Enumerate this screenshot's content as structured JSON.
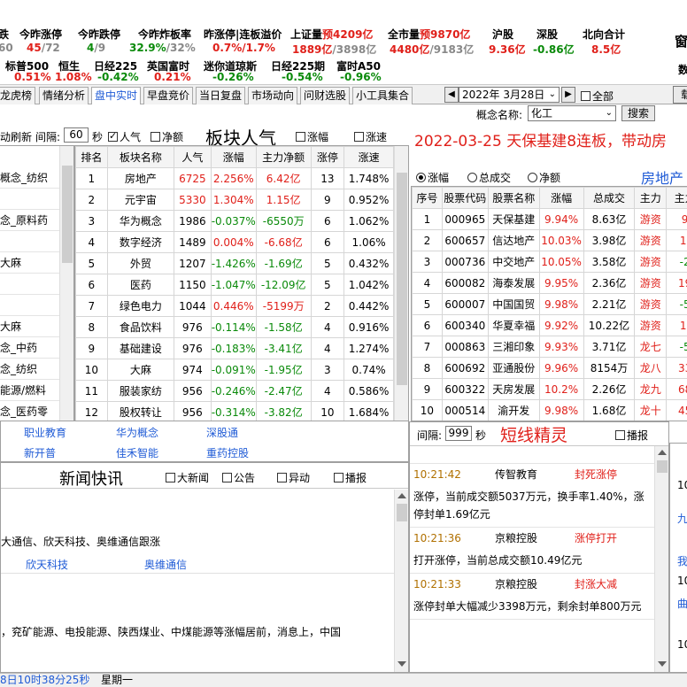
{
  "market": {
    "row1": [
      {
        "label": "涨停",
        "value": "45",
        "value2": "/72"
      },
      {
        "label": "今昨涨停",
        "value": "45",
        "value2": "/72"
      },
      {
        "label": "今昨跌停",
        "value": "4",
        "value2": "/9"
      },
      {
        "label": "今昨炸板率",
        "value": "32.9%",
        "value2": "/32%"
      },
      {
        "label": "昨涨停|连板溢价",
        "value": "0.7%",
        "value2": "/1.7%"
      },
      {
        "label": "上证量",
        "label_red": "预4209亿",
        "value": "1889亿",
        "value2": "/3898亿"
      },
      {
        "label": "全市量",
        "label_red": "预9870亿",
        "value": "4480亿",
        "value2": "/9183亿"
      },
      {
        "label": "沪股",
        "value": "9.36亿"
      },
      {
        "label": "深股",
        "value": "-0.86亿"
      },
      {
        "label": "北向合计",
        "value": "8.5亿"
      }
    ],
    "col0_label_tail": "跌",
    "col0_value_tail": "60",
    "row2": [
      {
        "label": "标普500",
        "value": "0.51%"
      },
      {
        "label": "恒生",
        "value": "1.08%"
      },
      {
        "label": "日经225",
        "value": "-0.42%"
      },
      {
        "label": "英国富时",
        "value": "0.21%"
      },
      {
        "label": "迷你道琼斯",
        "value": "-0.26%"
      },
      {
        "label": "日经225期",
        "value": "-0.54%"
      },
      {
        "label": "富时A50",
        "value": "-0.96%"
      }
    ],
    "right_edge1": "窗",
    "right_edge2": "数"
  },
  "tabs": [
    "龙虎榜",
    "情绪分析",
    "盘中实时",
    "早盘竞价",
    "当日复盘",
    "市场动向",
    "问财选股",
    "小工具集合"
  ],
  "active_tab": "盘中实时",
  "date": {
    "prev": "◀",
    "value": "2022年  3月28日",
    "next": "▶",
    "all_label": "全部",
    "concept_label": "概念名称:",
    "concept_value": "化工",
    "search": "搜索",
    "right_btn": "载"
  },
  "board": {
    "refresh_label": "动刷新",
    "interval_label": "间隔:",
    "interval_value": "60",
    "sec": "秒",
    "popularity": "人气",
    "net": "净额",
    "title": "板块人气",
    "rise": "涨幅",
    "speed": "涨速",
    "headers": [
      "排名",
      "板块名称",
      "人气",
      "涨幅",
      "主力净额",
      "涨停",
      "涨速"
    ],
    "rows": [
      [
        "1",
        "房地产",
        "6725",
        "2.256%",
        "6.42亿",
        "13",
        "1.748%"
      ],
      [
        "2",
        "元宇宙",
        "5330",
        "1.304%",
        "1.15亿",
        "9",
        "0.952%"
      ],
      [
        "3",
        "华为概念",
        "1986",
        "-0.037%",
        "-6550万",
        "6",
        "1.062%"
      ],
      [
        "4",
        "数字经济",
        "1489",
        "0.004%",
        "-6.68亿",
        "6",
        "1.06%"
      ],
      [
        "5",
        "外贸",
        "1207",
        "-1.426%",
        "-1.69亿",
        "5",
        "0.432%"
      ],
      [
        "6",
        "医药",
        "1150",
        "-1.047%",
        "-12.09亿",
        "5",
        "1.042%"
      ],
      [
        "7",
        "绿色电力",
        "1044",
        "0.446%",
        "-5199万",
        "2",
        "0.442%"
      ],
      [
        "8",
        "食品饮料",
        "976",
        "-0.114%",
        "-1.58亿",
        "4",
        "0.916%"
      ],
      [
        "9",
        "基础建设",
        "976",
        "-0.183%",
        "-3.41亿",
        "4",
        "1.274%"
      ],
      [
        "10",
        "大麻",
        "974",
        "-0.091%",
        "-1.95亿",
        "3",
        "0.74%"
      ],
      [
        "11",
        "服装家纺",
        "956",
        "-0.246%",
        "-2.47亿",
        "4",
        "0.586%"
      ],
      [
        "12",
        "股权转让",
        "956",
        "-0.314%",
        "-3.82亿",
        "10",
        "1.684%"
      ]
    ],
    "row_colors": [
      "red",
      "red",
      "green",
      "red",
      "green",
      "green",
      "red",
      "green",
      "green",
      "green",
      "green",
      "green"
    ],
    "left_items": [
      "概念_纺织",
      "",
      "念_原料药",
      "",
      "大麻",
      "",
      "",
      "大麻",
      "念_中药",
      "念_纺织",
      "能源/燃料",
      "念_医药零"
    ],
    "links": [
      [
        "职业教育",
        "华为概念",
        "深股通"
      ],
      [
        "新开普",
        "佳禾智能",
        "重药控股"
      ]
    ]
  },
  "headline": {
    "text": "2022-03-25   天保基建8连板，带动房",
    "subtitle": "房地产"
  },
  "stocks": {
    "options": [
      "涨幅",
      "总成交",
      "净额"
    ],
    "headers": [
      "序号",
      "股票代码",
      "股票名称",
      "涨幅",
      "总成交",
      "主力",
      "主力"
    ],
    "rows": [
      [
        "1",
        "000965",
        "天保基建",
        "9.94%",
        "8.63亿",
        "游资",
        "9"
      ],
      [
        "2",
        "600657",
        "信达地产",
        "10.03%",
        "3.98亿",
        "游资",
        "1."
      ],
      [
        "3",
        "000736",
        "中交地产",
        "10.05%",
        "3.58亿",
        "游资",
        "-2"
      ],
      [
        "4",
        "600082",
        "海泰发展",
        "9.95%",
        "2.36亿",
        "游资",
        "19"
      ],
      [
        "5",
        "600007",
        "中国国贸",
        "9.98%",
        "2.21亿",
        "游资",
        "-5"
      ],
      [
        "6",
        "600340",
        "华夏幸福",
        "9.92%",
        "10.22亿",
        "游资",
        "1."
      ],
      [
        "7",
        "000863",
        "三湘印象",
        "9.93%",
        "3.71亿",
        "龙七",
        "-5"
      ],
      [
        "8",
        "600692",
        "亚通股份",
        "9.96%",
        "8154万",
        "龙八",
        "33"
      ],
      [
        "9",
        "600322",
        "天房发展",
        "10.2%",
        "2.26亿",
        "龙九",
        "68"
      ],
      [
        "10",
        "000514",
        "渝开发",
        "9.98%",
        "1.68亿",
        "龙十",
        "45"
      ]
    ]
  },
  "news": {
    "title": "新闻快讯",
    "options": [
      "大新闻",
      "公告",
      "异动",
      "播报"
    ],
    "line1": "大通信、欣天科技、奥维通信跟涨",
    "link1": "欣天科技",
    "link2": "奥维通信",
    "line2": "，兖矿能源、电投能源、陕西煤业、中煤能源等涨幅居前，消息上，中国"
  },
  "flash": {
    "interval_label": "间隔:",
    "interval_value": "999",
    "sec": "秒",
    "title": "短线精灵",
    "broadcast": "播报",
    "items": [
      {
        "time": "10:21:42",
        "stock": "传智教育",
        "event": "封死涨停",
        "text": "涨停，当前成交额5037万元，换手率1.40%，涨停封单1.69亿元"
      },
      {
        "time": "10:21:36",
        "stock": "京粮控股",
        "event": "涨停打开",
        "text": "打开涨停，当前总成交额10.49亿元"
      },
      {
        "time": "10:21:33",
        "stock": "京粮控股",
        "event": "封涨大减",
        "text": "涨停封单大幅减少3398万元，剩余封单800万元"
      }
    ],
    "right_items": [
      "10",
      "九",
      "我",
      "10",
      "曲",
      "10"
    ]
  },
  "status": {
    "time": "8日10时38分25秒",
    "weekday": "星期一"
  }
}
